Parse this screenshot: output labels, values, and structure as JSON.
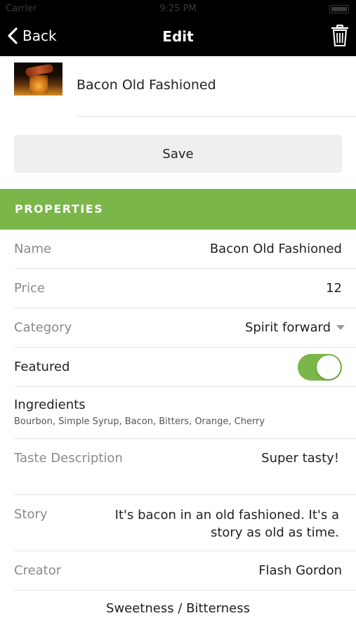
{
  "status_bar": {
    "carrier": "Carrier",
    "time": "9:25 PM"
  },
  "nav": {
    "back_label": "Back",
    "title": "Edit"
  },
  "drink": {
    "name": "Bacon Old Fashioned"
  },
  "actions": {
    "save_label": "Save"
  },
  "section": {
    "title": "PROPERTIES"
  },
  "properties": {
    "name": {
      "label": "Name",
      "value": "Bacon Old Fashioned"
    },
    "price": {
      "label": "Price",
      "value": "12"
    },
    "category": {
      "label": "Category",
      "value": "Spirit forward"
    },
    "featured": {
      "label": "Featured",
      "value": true
    },
    "ingredients": {
      "label": "Ingredients",
      "value": "Bourbon, Simple Syrup, Bacon, Bitters, Orange, Cherry"
    },
    "taste": {
      "label": "Taste Description",
      "value": "Super tasty!"
    },
    "story": {
      "label": "Story",
      "value": "It's bacon in an old fashioned. It's a story as old as time."
    },
    "creator": {
      "label": "Creator",
      "value": "Flash Gordon"
    }
  },
  "sliders": {
    "title": "Sweetness / Bitterness"
  },
  "icons": {
    "back": "chevron-left-icon",
    "trash": "trash-icon",
    "dropdown": "caret-down-icon",
    "thumbnail": "drink-photo"
  },
  "colors": {
    "accent_green": "#7ab649",
    "nav_background": "#000000",
    "save_button_bg": "#efefef",
    "label_gray": "#8a8a8a"
  }
}
